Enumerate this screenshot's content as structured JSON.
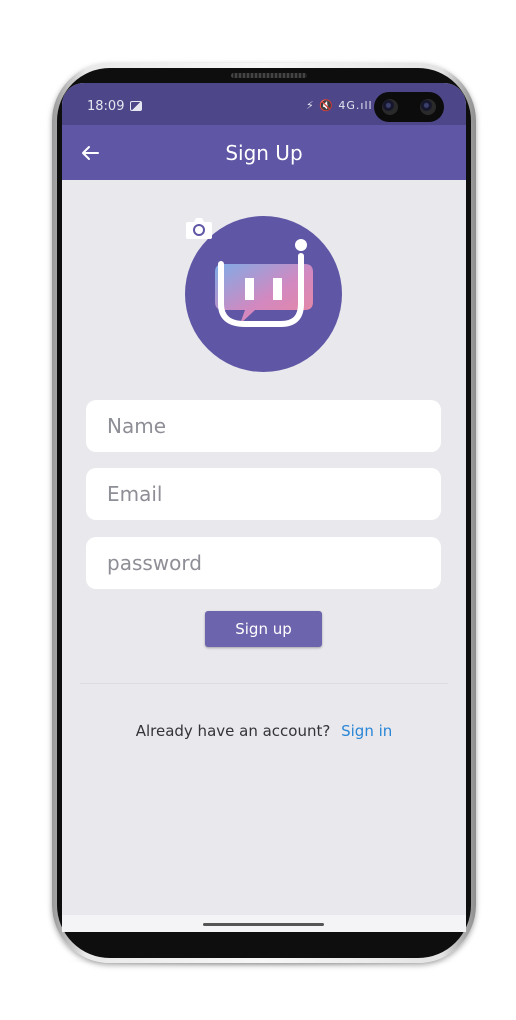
{
  "status_bar": {
    "time": "18:09",
    "icons_text": "⚡ 🔇 4G.ıll 9"
  },
  "app_bar": {
    "back_icon": "arrow-left-icon",
    "title": "Sign Up"
  },
  "form": {
    "name_placeholder": "Name",
    "email_placeholder": "Email",
    "password_placeholder": "password",
    "submit_label": "Sign up"
  },
  "footer": {
    "prompt": "Already have an account?",
    "link": "Sign in"
  },
  "colors": {
    "primary": "#5f57a5",
    "button": "#6c64ad",
    "link": "#2a86d6",
    "background": "#e8e8ed"
  }
}
